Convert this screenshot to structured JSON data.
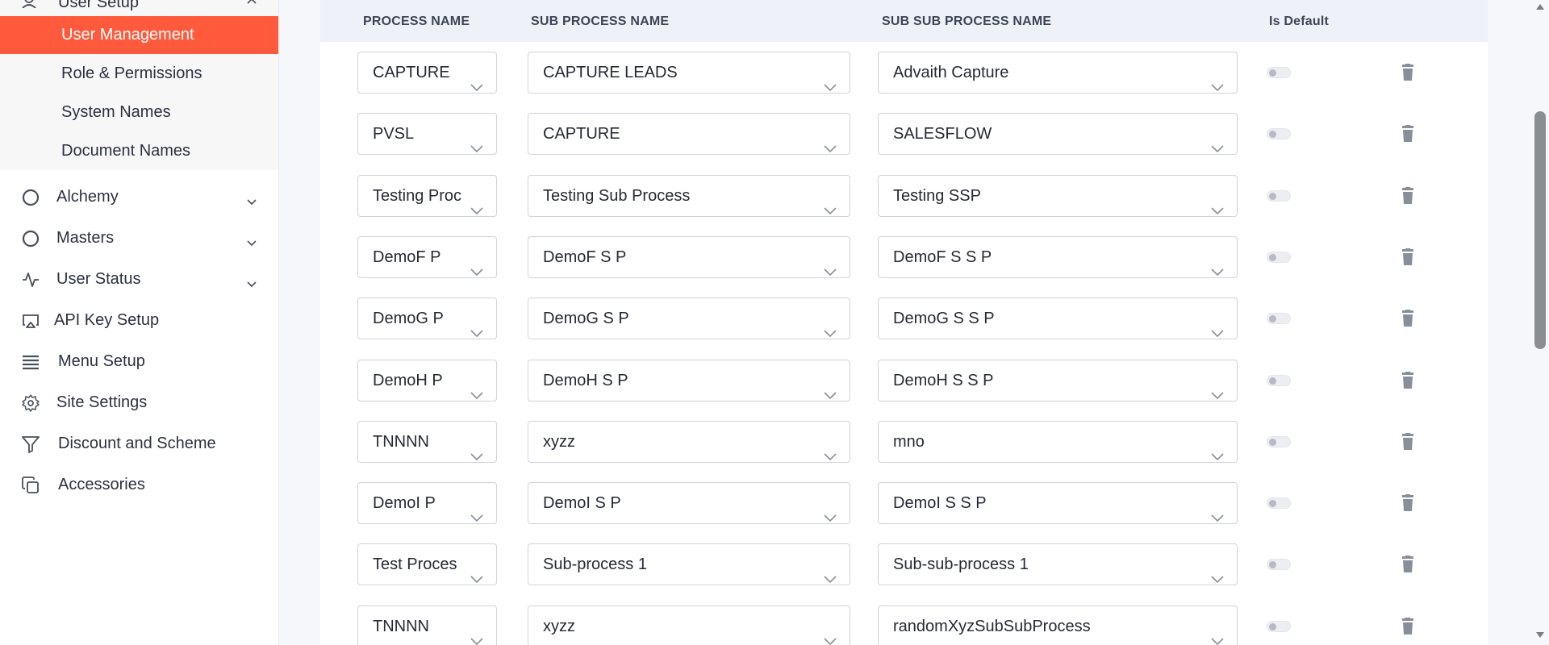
{
  "sidebar": {
    "group": {
      "label": "User Setup",
      "items": [
        {
          "label": "User Management",
          "active": true
        },
        {
          "label": "Role & Permissions",
          "active": false
        },
        {
          "label": "System Names",
          "active": false
        },
        {
          "label": "Document Names",
          "active": false
        }
      ]
    },
    "items": [
      {
        "label": "Alchemy",
        "icon": "circle-icon",
        "expandable": true
      },
      {
        "label": "Masters",
        "icon": "circle-icon",
        "expandable": true
      },
      {
        "label": "User Status",
        "icon": "activity-icon",
        "expandable": true
      },
      {
        "label": "API Key Setup",
        "icon": "cast-icon",
        "expandable": false
      },
      {
        "label": "Menu Setup",
        "icon": "menu-icon",
        "expandable": false
      },
      {
        "label": "Site Settings",
        "icon": "gear-icon",
        "expandable": false
      },
      {
        "label": "Discount and Scheme",
        "icon": "filter-icon",
        "expandable": false
      },
      {
        "label": "Accessories",
        "icon": "copy-icon",
        "expandable": false
      }
    ]
  },
  "table": {
    "headers": {
      "process": "PROCESS NAME",
      "sub_process": "SUB PROCESS NAME",
      "sub_sub_process": "SUB SUB PROCESS NAME",
      "is_default": "Is Default"
    },
    "rows": [
      {
        "process": "CAPTURE",
        "sub_process": "CAPTURE LEADS",
        "sub_sub_process": "Advaith Capture",
        "is_default": false
      },
      {
        "process": "PVSL",
        "sub_process": "CAPTURE",
        "sub_sub_process": "SALESFLOW",
        "is_default": false
      },
      {
        "process": "Testing Proc",
        "sub_process": "Testing Sub Process",
        "sub_sub_process": "Testing SSP",
        "is_default": false
      },
      {
        "process": "DemoF P",
        "sub_process": "DemoF S P",
        "sub_sub_process": "DemoF S S P",
        "is_default": false
      },
      {
        "process": "DemoG P",
        "sub_process": "DemoG S P",
        "sub_sub_process": "DemoG S S P",
        "is_default": false
      },
      {
        "process": "DemoH P",
        "sub_process": "DemoH S P",
        "sub_sub_process": "DemoH S S P",
        "is_default": false
      },
      {
        "process": "TNNNN",
        "sub_process": "xyzz",
        "sub_sub_process": "mno",
        "is_default": false
      },
      {
        "process": "DemoI P",
        "sub_process": "DemoI S P",
        "sub_sub_process": "DemoI S S P",
        "is_default": false
      },
      {
        "process": "Test Proces",
        "sub_process": "Sub-process 1",
        "sub_sub_process": "Sub-sub-process 1",
        "is_default": false
      },
      {
        "process": "TNNNN",
        "sub_process": "xyzz",
        "sub_sub_process": "randomXyzSubSubProcess",
        "is_default": false
      }
    ]
  },
  "colors": {
    "accent": "#ff5a3c",
    "header_bg": "#eef2f8",
    "delete_icon": "#8a8e99"
  }
}
